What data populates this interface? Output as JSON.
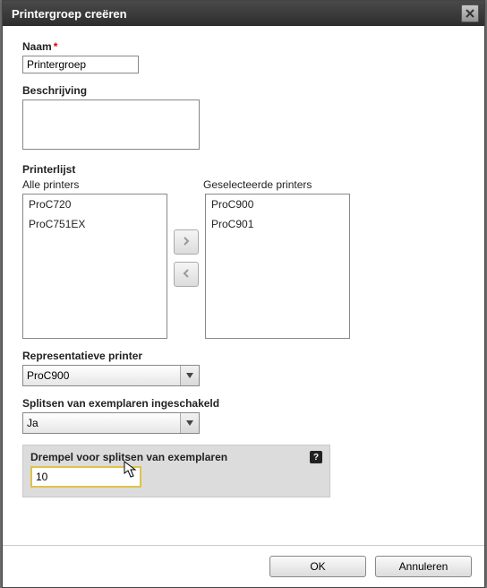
{
  "dialog": {
    "title": "Printergroep creëren"
  },
  "fields": {
    "name_label": "Naam",
    "name_value": "Printergroep",
    "desc_label": "Beschrijving",
    "desc_value": "",
    "printerlist_label": "Printerlijst",
    "all_label": "Alle printers",
    "selected_label": "Geselecteerde printers",
    "all_printers": [
      "ProC720",
      "ProC751EX"
    ],
    "selected_printers": [
      "ProC900",
      "ProC901"
    ],
    "rep_label": "Representatieve printer",
    "rep_value": "ProC900",
    "split_label": "Splitsen van exemplaren ingeschakeld",
    "split_value": "Ja",
    "threshold_label": "Drempel voor splitsen van exemplaren",
    "threshold_value": "10"
  },
  "buttons": {
    "ok": "OK",
    "cancel": "Annuleren"
  }
}
